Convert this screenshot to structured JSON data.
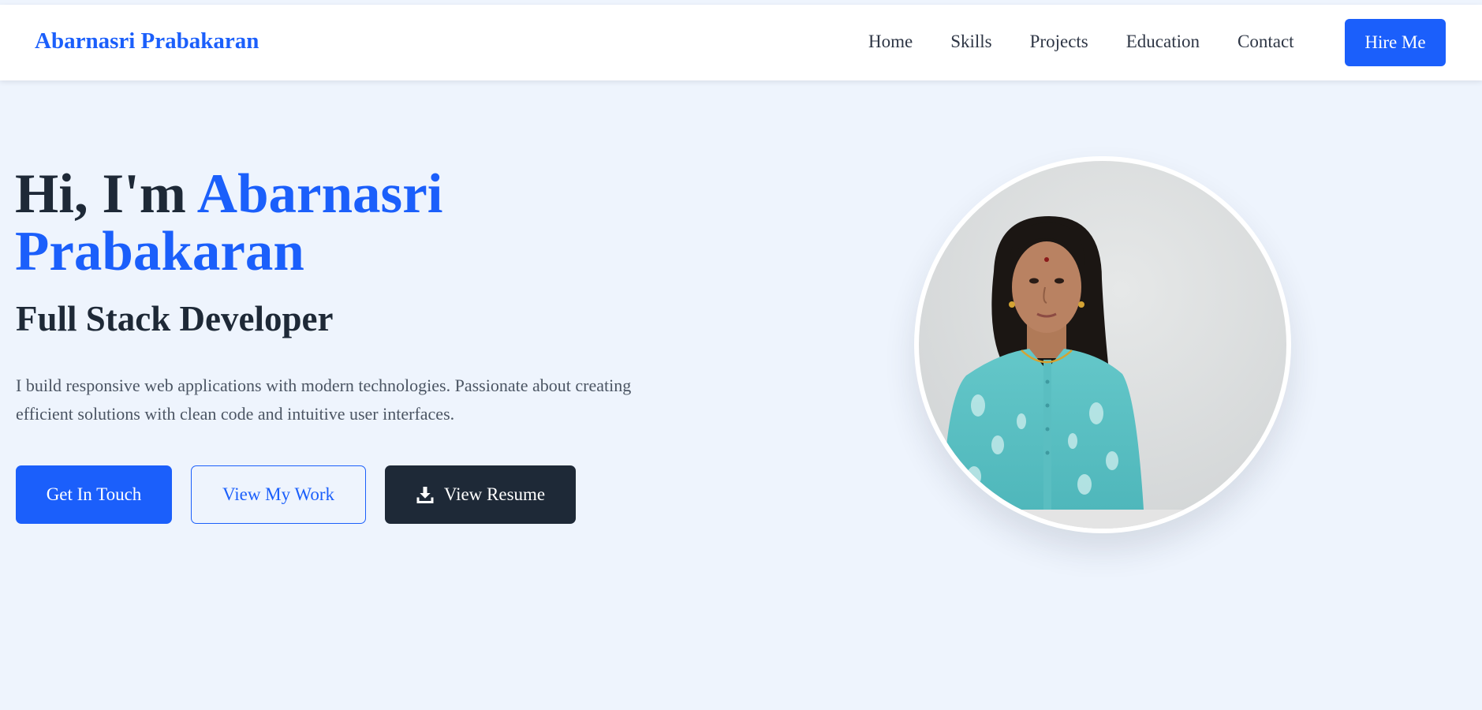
{
  "header": {
    "brand": "Abarnasri Prabakaran",
    "nav": [
      "Home",
      "Skills",
      "Projects",
      "Education",
      "Contact"
    ],
    "cta_label": "Hire Me"
  },
  "hero": {
    "greeting": "Hi, I'm",
    "name_first": "Abarnasri",
    "name_last": "Prabakaran",
    "role": "Full Stack Developer",
    "description": "I build responsive web applications with modern technologies. Passionate about creating efficient solutions with clean code and intuitive user interfaces.",
    "buttons": {
      "contact": "Get In Touch",
      "work": "View My Work",
      "resume": "View Resume"
    },
    "resume_icon": "download-icon",
    "photo_icon": "profile-photo"
  },
  "colors": {
    "accent": "#1b5ffb",
    "dark": "#1e2937",
    "page_background": "#eef4fd",
    "body_text": "#4b5563"
  }
}
